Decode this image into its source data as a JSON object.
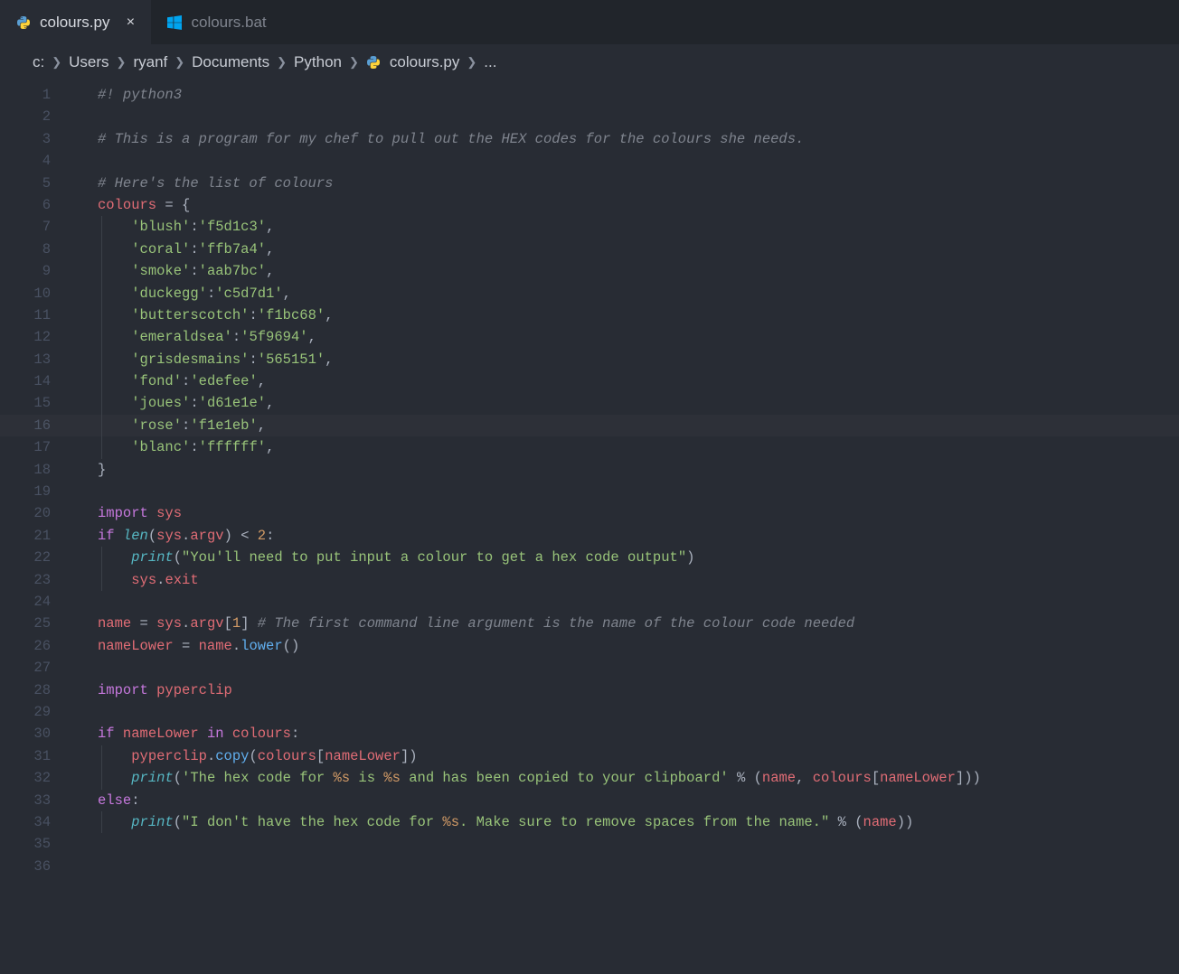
{
  "tabs": [
    {
      "label": "colours.py",
      "icon": "python-icon",
      "active": true,
      "dirty": false
    },
    {
      "label": "colours.bat",
      "icon": "windows-icon",
      "active": false,
      "dirty": false
    }
  ],
  "breadcrumb": {
    "segments": [
      "c:",
      "Users",
      "ryanf",
      "Documents",
      "Python"
    ],
    "file": "colours.py",
    "trail": "..."
  },
  "editor": {
    "current_line": 16,
    "line_count": 36,
    "code": {
      "l1": "#! python3",
      "l3": "# This is a program for my chef to pull out the HEX codes for the colours she needs.",
      "l5": "# Here's the list of colours",
      "l6_var": "colours",
      "l6_rest": " = {",
      "dict": [
        {
          "k": "blush",
          "v": "f5d1c3"
        },
        {
          "k": "coral",
          "v": "ffb7a4"
        },
        {
          "k": "smoke",
          "v": "aab7bc"
        },
        {
          "k": "duckegg",
          "v": "c5d7d1"
        },
        {
          "k": "butterscotch",
          "v": "f1bc68"
        },
        {
          "k": "emeraldsea",
          "v": "5f9694"
        },
        {
          "k": "grisdesmains",
          "v": "565151"
        },
        {
          "k": "fond",
          "v": "edefee"
        },
        {
          "k": "joues",
          "v": "d61e1e"
        },
        {
          "k": "rose",
          "v": "f1e1eb"
        },
        {
          "k": "blanc",
          "v": "ffffff"
        }
      ],
      "l18": "}",
      "l20_kw": "import",
      "l20_mod": "sys",
      "l21_if": "if",
      "l21_len": "len",
      "l21_sys": "sys",
      "l21_argv": "argv",
      "l21_op": " < ",
      "l21_num": "2",
      "l21_colon": ":",
      "l22_print": "print",
      "l22_str": "\"You'll need to put input a colour to get a hex code output\"",
      "l23_sys": "sys",
      "l23_exit": "exit",
      "l25_name": "name",
      "l25_eq": " = ",
      "l25_sys": "sys",
      "l25_argv": "argv",
      "l25_idx": "1",
      "l25_comment": "# The first command line argument is the name of the colour code needed",
      "l26_nameLower": "nameLower",
      "l26_eq": " = ",
      "l26_name": "name",
      "l26_lower": "lower",
      "l28_import": "import",
      "l28_mod": "pyperclip",
      "l30_if": "if",
      "l30_nameLower": "nameLower",
      "l30_in": "in",
      "l30_colours": "colours",
      "l31_mod": "pyperclip",
      "l31_copy": "copy",
      "l31_colours": "colours",
      "l31_nameLower": "nameLower",
      "l32_print": "print",
      "l32_str_a": "'The hex code for ",
      "l32_fmt1": "%s",
      "l32_str_b": " is ",
      "l32_fmt2": "%s",
      "l32_str_c": " and has been copied to your clipboard'",
      "l32_name": "name",
      "l32_colours": "colours",
      "l32_nameLower": "nameLower",
      "l33_else": "else",
      "l34_print": "print",
      "l34_str_a": "\"I don't have the hex code for ",
      "l34_fmt": "%s",
      "l34_str_b": ". Make sure to remove spaces from the name.\"",
      "l34_name": "name"
    }
  }
}
